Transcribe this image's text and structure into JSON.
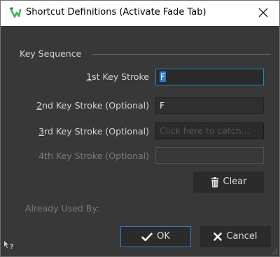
{
  "window": {
    "title": "Shortcut Definitions (Activate Fade Tab)",
    "close_icon": "close-icon",
    "app_icon": "wavelab-logo-icon"
  },
  "group": {
    "legend": "Key Sequence"
  },
  "fields": [
    {
      "label_mnemonic": "1",
      "label_rest": "st Key Stroke",
      "value": "F",
      "state": "focused"
    },
    {
      "label_mnemonic": "2",
      "label_rest": "nd Key Stroke (Optional)",
      "value": "F",
      "state": "normal"
    },
    {
      "label_mnemonic": "3",
      "label_rest": "rd Key Stroke (Optional)",
      "placeholder": "Click here to catch...",
      "state": "catch"
    },
    {
      "label": "4th Key Stroke (Optional)",
      "value": "",
      "state": "disabled"
    }
  ],
  "clear_button": {
    "label": "Clear",
    "icon": "trash-icon"
  },
  "already_used": {
    "label": "Already Used By:"
  },
  "buttons": {
    "ok": {
      "label": "OK",
      "icon": "checkmark-icon"
    },
    "cancel": {
      "label": "Cancel",
      "icon": "x-mark-icon"
    }
  },
  "colors": {
    "background": "#383838",
    "focus_accent": "#1c88c8",
    "selection": "#2f7ac4",
    "logo_green": "#4caf50"
  }
}
